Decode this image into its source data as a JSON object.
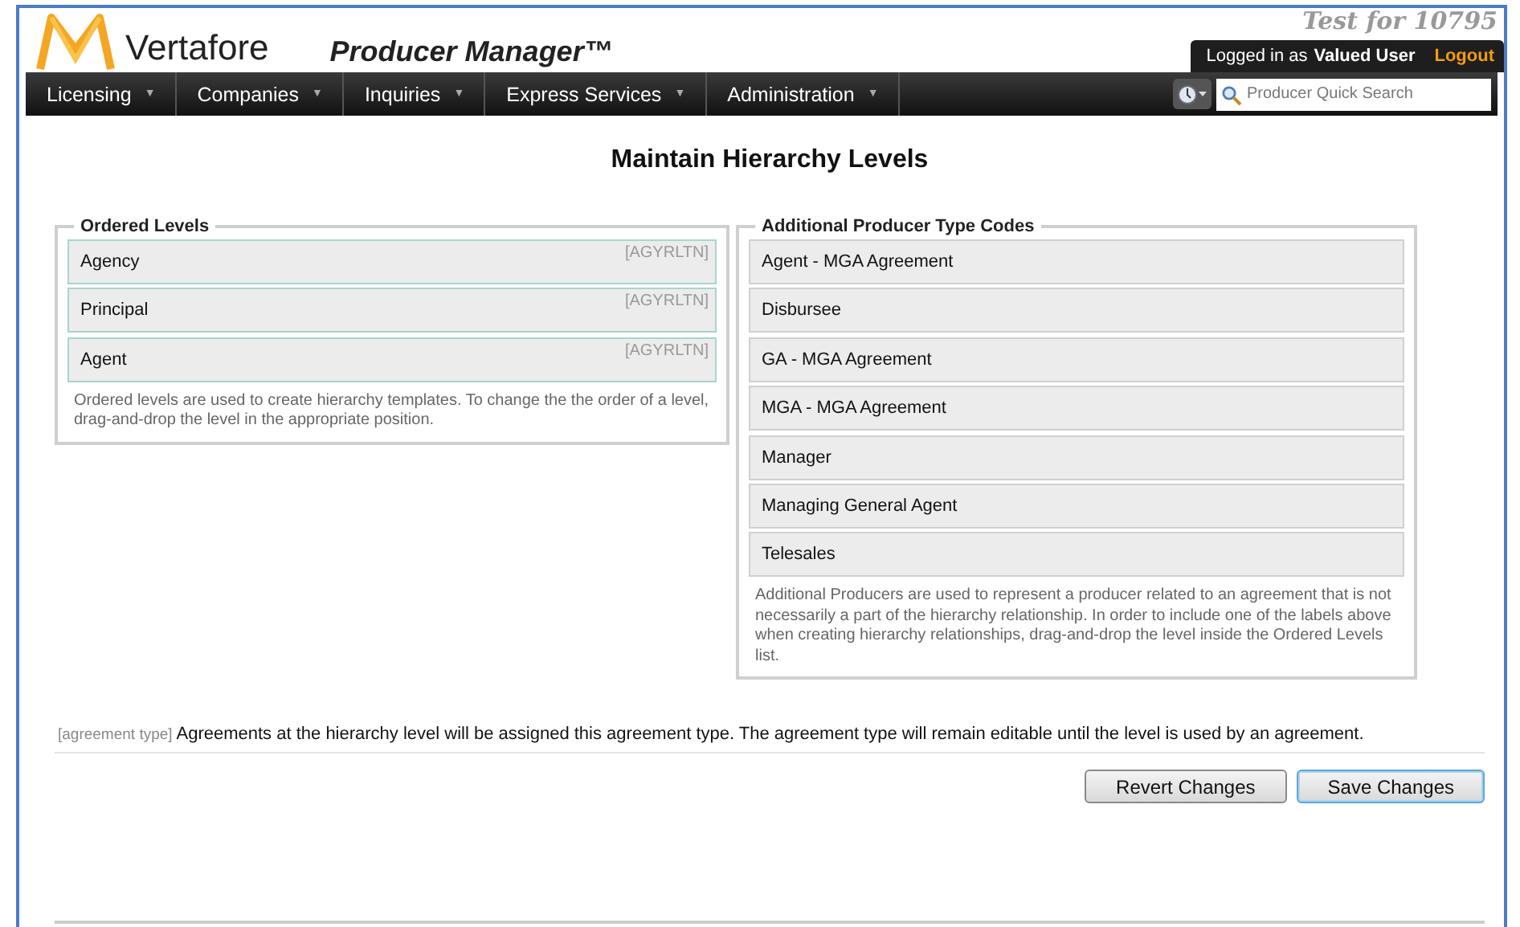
{
  "header": {
    "brand": "Vertafore",
    "product": "Producer Manager™",
    "environment": "Test for 10795",
    "login_prefix": "Logged in as",
    "user": "Valued User",
    "logout": "Logout"
  },
  "nav": {
    "items": [
      {
        "label": "Licensing",
        "caret": "▼"
      },
      {
        "label": "Companies",
        "caret": "▼"
      },
      {
        "label": "Inquiries",
        "caret": "▼"
      },
      {
        "label": "Express Services",
        "caret": "▼"
      },
      {
        "label": "Administration",
        "caret": "▼"
      }
    ],
    "quick_search": {
      "placeholder": "Producer Quick Search"
    }
  },
  "page_title": "Maintain Hierarchy Levels",
  "ordered_levels": {
    "legend": "Ordered Levels",
    "items": [
      {
        "label": "Agency",
        "code": "[AGYRLTN]"
      },
      {
        "label": "Principal",
        "code": "[AGYRLTN]"
      },
      {
        "label": "Agent",
        "code": "[AGYRLTN]"
      }
    ],
    "note": "Ordered levels are used to create hierarchy templates. To change the the order of a level, drag-and-drop the level in the appropriate position."
  },
  "additional_types": {
    "legend": "Additional Producer Type Codes",
    "items": [
      {
        "label": "Agent - MGA Agreement"
      },
      {
        "label": "Disbursee"
      },
      {
        "label": "GA - MGA Agreement"
      },
      {
        "label": "MGA - MGA Agreement"
      },
      {
        "label": "Manager"
      },
      {
        "label": "Managing General Agent"
      },
      {
        "label": "Telesales"
      }
    ],
    "note": "Additional Producers are used to represent a producer related to an agreement that is not necessarily a part of the hierarchy relationship. In order to include one of the labels above when creating hierarchy relationships, drag-and-drop the level inside the Ordered Levels list."
  },
  "agreement_note": {
    "tag": "[agreement type]",
    "text": "Agreements at the hierarchy level will be assigned this agreement type. The agreement type will remain editable until the level is used by an agreement."
  },
  "buttons": [
    {
      "label": "Revert Changes",
      "focused": false
    },
    {
      "label": "Save Changes",
      "focused": true
    }
  ]
}
